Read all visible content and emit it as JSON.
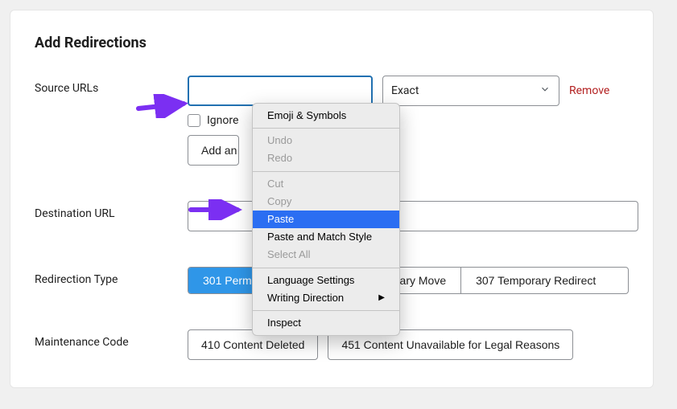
{
  "sectionTitle": "Add Redirections",
  "labels": {
    "sourceUrls": "Source URLs",
    "destinationUrl": "Destination URL",
    "redirectionType": "Redirection Type",
    "maintenanceCode": "Maintenance Code"
  },
  "sourceInput": "",
  "matchSelect": {
    "value": "Exact"
  },
  "removeLink": "Remove",
  "ignoreCheckbox": "Ignore",
  "addAnotherBtn": "Add an",
  "destinationInput": "",
  "redirectionTypes": [
    {
      "label": "301 Permanent Move",
      "active": true
    },
    {
      "label": "302 Temporary Move",
      "active": false
    },
    {
      "label": "307 Temporary Redirect",
      "active": false
    }
  ],
  "maintenanceCodes": [
    {
      "label": "410 Content Deleted"
    },
    {
      "label": "451 Content Unavailable for Legal Reasons"
    }
  ],
  "contextMenu": {
    "emoji": "Emoji & Symbols",
    "undo": "Undo",
    "redo": "Redo",
    "cut": "Cut",
    "copy": "Copy",
    "paste": "Paste",
    "pasteMatch": "Paste and Match Style",
    "selectAll": "Select All",
    "language": "Language Settings",
    "writing": "Writing Direction",
    "inspect": "Inspect"
  }
}
